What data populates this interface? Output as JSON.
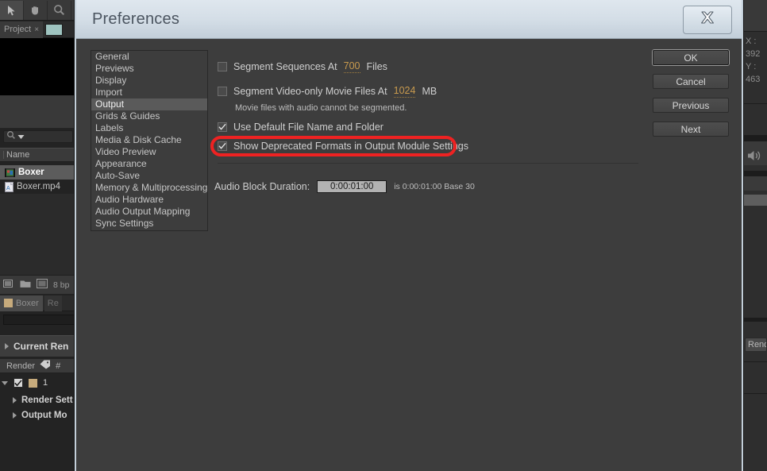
{
  "app": {
    "toolbar": {
      "tools": [
        {
          "name": "selection-tool",
          "icon": "arrow-icon",
          "selected": true
        },
        {
          "name": "hand-tool",
          "icon": "hand-icon",
          "selected": false
        },
        {
          "name": "zoom-tool",
          "icon": "magnifier-icon",
          "selected": false
        }
      ]
    },
    "project_panel": {
      "tab_label": "Project",
      "close_glyph": "×",
      "search_placeholder": "",
      "column_header": "Name",
      "items": [
        {
          "label": "Boxer",
          "type": "composition",
          "selected": true
        },
        {
          "label": "Boxer.mp4",
          "type": "footage",
          "selected": false
        }
      ],
      "footer_bit_depth": "8 bp"
    },
    "render_queue": {
      "tab_label": "Boxer",
      "tab2_label": "Re",
      "section_label": "Current Ren",
      "column_render": "Render",
      "column_extra": "#",
      "row_number": "1",
      "sub_rows": [
        "Render Sett",
        "Output Mo"
      ]
    },
    "right_strip": {
      "coord_x": "X : 392",
      "coord_y": "Y : 463",
      "render_button": "Rend",
      "speaker_icon": "speaker-icon"
    }
  },
  "dialog": {
    "title": "Preferences",
    "close_label": "✕",
    "categories": [
      {
        "label": "General",
        "active": false
      },
      {
        "label": "Previews",
        "active": false
      },
      {
        "label": "Display",
        "active": false
      },
      {
        "label": "Import",
        "active": false
      },
      {
        "label": "Output",
        "active": true
      },
      {
        "label": "Grids & Guides",
        "active": false
      },
      {
        "label": "Labels",
        "active": false
      },
      {
        "label": "Media & Disk Cache",
        "active": false
      },
      {
        "label": "Video Preview",
        "active": false
      },
      {
        "label": "Appearance",
        "active": false
      },
      {
        "label": "Auto-Save",
        "active": false
      },
      {
        "label": "Memory & Multiprocessing",
        "active": false
      },
      {
        "label": "Audio Hardware",
        "active": false
      },
      {
        "label": "Audio Output Mapping",
        "active": false
      },
      {
        "label": "Sync Settings",
        "active": false
      }
    ],
    "options": {
      "segment_sequences": {
        "label": "Segment Sequences At",
        "checked": false,
        "value": "700",
        "unit": "Files"
      },
      "segment_video": {
        "label": "Segment Video-only Movie Files At",
        "checked": false,
        "value": "1024",
        "unit": "MB"
      },
      "segment_video_hint": "Movie files with audio cannot be segmented.",
      "use_default_file_name": {
        "label": "Use Default File Name and Folder",
        "checked": true
      },
      "show_deprecated": {
        "label": "Show Deprecated Formats in Output Module Settings",
        "checked": true,
        "highlighted": true
      }
    },
    "audio_block": {
      "label": "Audio Block Duration:",
      "value": "0:00:01:00",
      "suffix": "is 0:00:01:00  Base 30"
    },
    "buttons": [
      {
        "label": "OK",
        "default": true
      },
      {
        "label": "Cancel",
        "default": false
      },
      {
        "label": "Previous",
        "default": false
      },
      {
        "label": "Next",
        "default": false
      }
    ]
  },
  "colors": {
    "annotation": "#ee2222",
    "value_text": "#c89a4e",
    "dialog_titlebar": "#d3dde6",
    "dialog_body": "#3d3d3d",
    "selection": "#5a5a5a"
  }
}
